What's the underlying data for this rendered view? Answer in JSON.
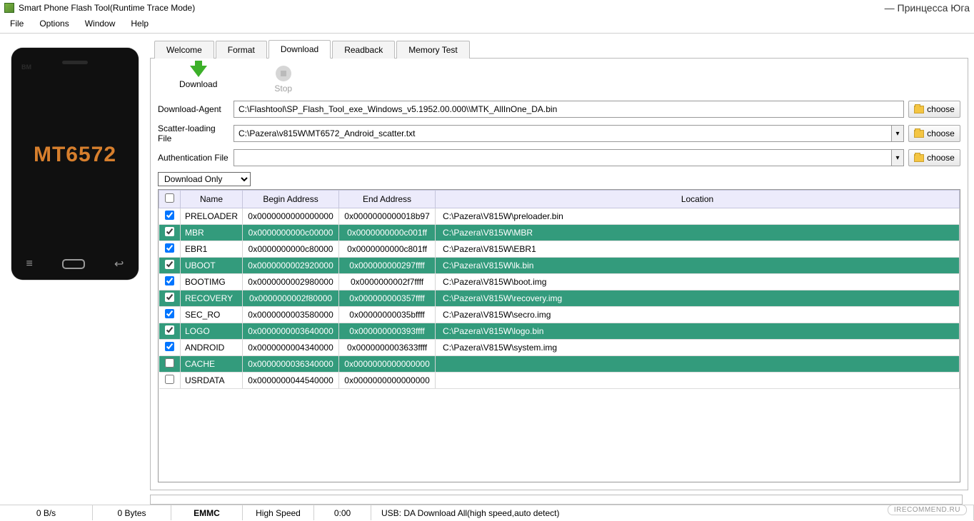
{
  "title": "Smart Phone Flash Tool(Runtime Trace Mode)",
  "watermark_author": "— Принцесса Юга",
  "watermark_site": "IRECOMMEND.RU",
  "menu": {
    "file": "File",
    "options": "Options",
    "window": "Window",
    "help": "Help"
  },
  "phone": {
    "bm": "BM",
    "chip": "MT6572"
  },
  "tabs": {
    "welcome": "Welcome",
    "format": "Format",
    "download": "Download",
    "readback": "Readback",
    "memory_test": "Memory Test"
  },
  "toolbar": {
    "download": "Download",
    "stop": "Stop"
  },
  "form": {
    "da_label": "Download-Agent",
    "da_value": "C:\\Flashtool\\SP_Flash_Tool_exe_Windows_v5.1952.00.000\\\\MTK_AllInOne_DA.bin",
    "scatter_label": "Scatter-loading File",
    "scatter_value": "C:\\Pazera\\v815W\\MT6572_Android_scatter.txt",
    "auth_label": "Authentication File",
    "auth_value": "",
    "choose": "choose",
    "mode": "Download Only"
  },
  "headers": {
    "name": "Name",
    "begin": "Begin Address",
    "end": "End Address",
    "location": "Location"
  },
  "rows": [
    {
      "checked": true,
      "green": false,
      "name": "PRELOADER",
      "begin": "0x0000000000000000",
      "end": "0x0000000000018b97",
      "loc": "C:\\Pazera\\V815W\\preloader.bin"
    },
    {
      "checked": true,
      "green": true,
      "name": "MBR",
      "begin": "0x0000000000c00000",
      "end": "0x0000000000c001ff",
      "loc": "C:\\Pazera\\V815W\\MBR"
    },
    {
      "checked": true,
      "green": false,
      "name": "EBR1",
      "begin": "0x0000000000c80000",
      "end": "0x0000000000c801ff",
      "loc": "C:\\Pazera\\V815W\\EBR1"
    },
    {
      "checked": true,
      "green": true,
      "name": "UBOOT",
      "begin": "0x0000000002920000",
      "end": "0x000000000297ffff",
      "loc": "C:\\Pazera\\V815W\\lk.bin"
    },
    {
      "checked": true,
      "green": false,
      "name": "BOOTIMG",
      "begin": "0x0000000002980000",
      "end": "0x0000000002f7ffff",
      "loc": "C:\\Pazera\\V815W\\boot.img"
    },
    {
      "checked": true,
      "green": true,
      "name": "RECOVERY",
      "begin": "0x0000000002f80000",
      "end": "0x000000000357ffff",
      "loc": "C:\\Pazera\\V815W\\recovery.img"
    },
    {
      "checked": true,
      "green": false,
      "name": "SEC_RO",
      "begin": "0x0000000003580000",
      "end": "0x00000000035bffff",
      "loc": "C:\\Pazera\\V815W\\secro.img"
    },
    {
      "checked": true,
      "green": true,
      "name": "LOGO",
      "begin": "0x0000000003640000",
      "end": "0x000000000393ffff",
      "loc": "C:\\Pazera\\V815W\\logo.bin"
    },
    {
      "checked": true,
      "green": false,
      "name": "ANDROID",
      "begin": "0x0000000004340000",
      "end": "0x0000000003633ffff",
      "loc": "C:\\Pazera\\V815W\\system.img"
    },
    {
      "checked": false,
      "green": true,
      "name": "CACHE",
      "begin": "0x0000000036340000",
      "end": "0x0000000000000000",
      "loc": ""
    },
    {
      "checked": false,
      "green": false,
      "name": "USRDATA",
      "begin": "0x0000000044540000",
      "end": "0x0000000000000000",
      "loc": ""
    }
  ],
  "status": {
    "speed": "0 B/s",
    "bytes": "0 Bytes",
    "storage": "EMMC",
    "mode": "High Speed",
    "time": "0:00",
    "usb": "USB: DA Download All(high speed,auto detect)"
  }
}
